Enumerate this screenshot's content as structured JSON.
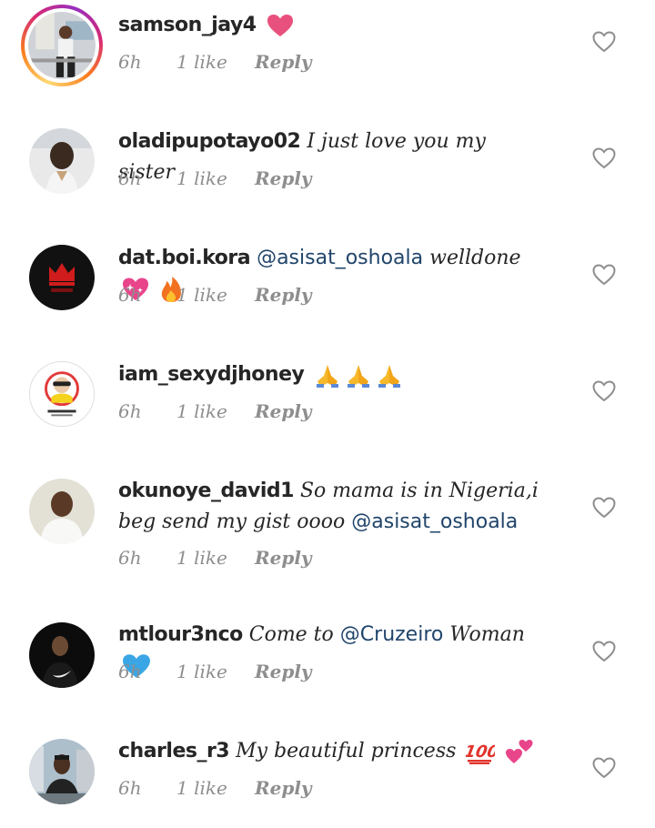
{
  "comments": [
    {
      "username": "samson_jay4",
      "text": "",
      "emoji": [
        "heart-pink-emoji"
      ],
      "time": "6h",
      "likes": "1 like",
      "reply": "Reply"
    },
    {
      "username": "oladipupotayo02",
      "text": "I just love you my sister",
      "time": "6h",
      "likes": "1 like",
      "reply": "Reply"
    },
    {
      "username": "dat.boi.kora",
      "mention": "@asisat_oshoala",
      "text": "welldone",
      "emoji": [
        "sparkling-heart-emoji",
        "fire-emoji"
      ],
      "time": "6h",
      "likes": "1 like",
      "reply": "Reply"
    },
    {
      "username": "iam_sexydjhoney",
      "text": "",
      "emoji": [
        "folded-hands-emoji",
        "folded-hands-emoji",
        "folded-hands-emoji"
      ],
      "time": "6h",
      "likes": "1 like",
      "reply": "Reply"
    },
    {
      "username": "okunoye_david1",
      "text": "So mama is in Nigeria,i beg send my gist oooo",
      "mention": "@asisat_oshoala",
      "time": "6h",
      "likes": "1 like",
      "reply": "Reply"
    },
    {
      "username": "mtlour3nco",
      "text": "Come to",
      "mention": "@Cruzeiro",
      "text_after": "Woman",
      "emoji": [
        "blue-heart-emoji"
      ],
      "time": "6h",
      "likes": "1 like",
      "reply": "Reply"
    },
    {
      "username": "charles_r3",
      "text": "My beautiful princess",
      "emoji": [
        "hundred-points-emoji",
        "two-hearts-emoji"
      ],
      "time": "6h",
      "likes": "1 like",
      "reply": "Reply"
    }
  ],
  "icons": {
    "like": "heart-outline-icon"
  },
  "colors": {
    "mention": "#21456b",
    "meta": "#8e8e8e",
    "text": "#262626"
  }
}
